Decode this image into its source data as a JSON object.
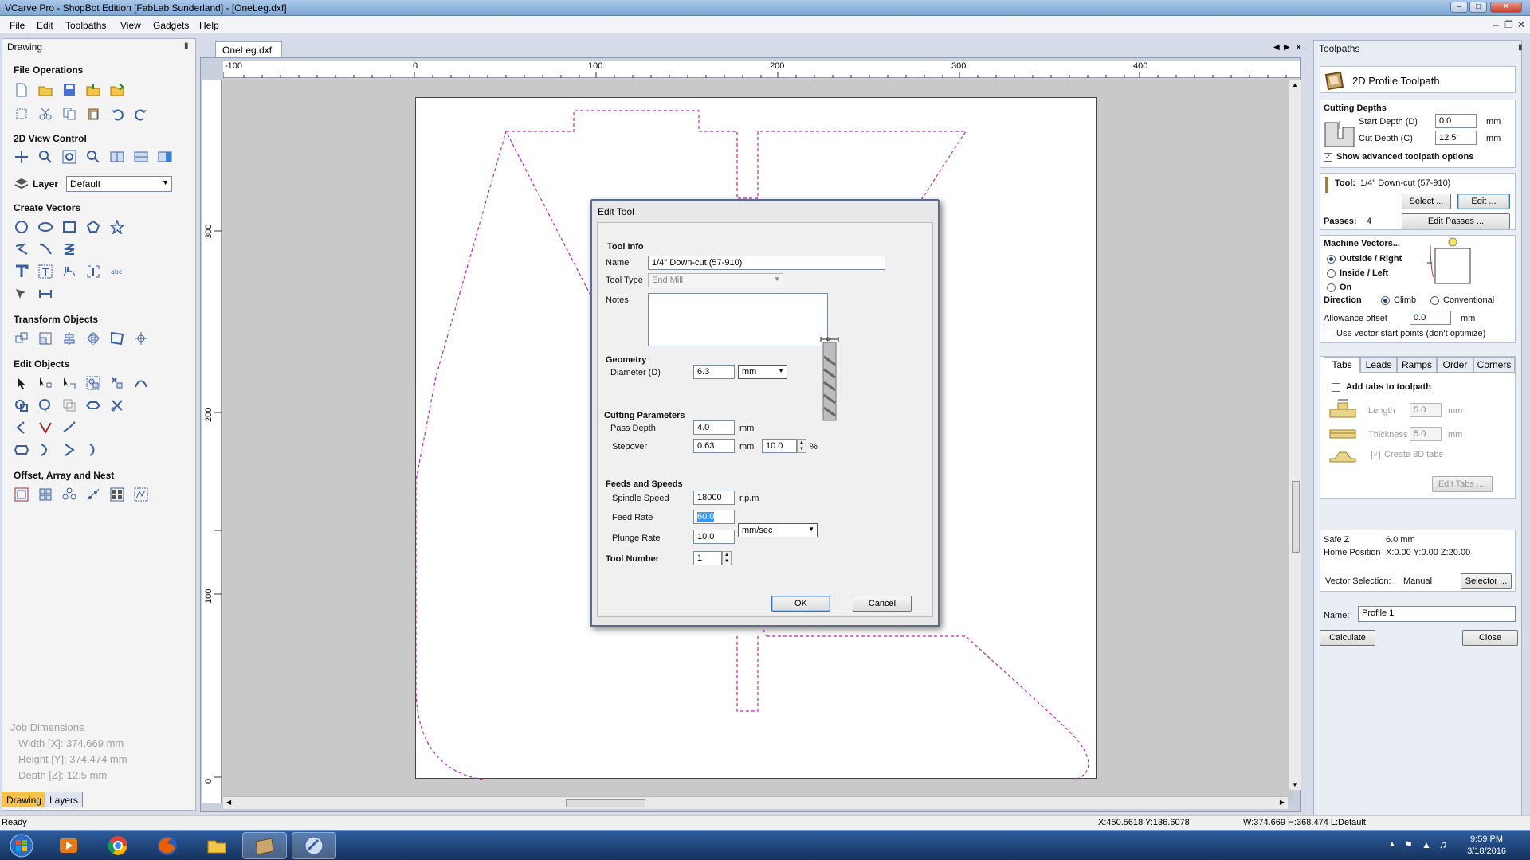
{
  "window": {
    "title": "VCarve Pro - ShopBot Edition [FabLab Sunderland] - [OneLeg.dxf]"
  },
  "menu": [
    "File",
    "Edit",
    "Toolpaths",
    "View",
    "Gadgets",
    "Help"
  ],
  "left_panel": {
    "header": "Drawing",
    "sections": {
      "file_ops": "File Operations",
      "view_ctrl": "2D View Control",
      "layer": "Layer",
      "create_vectors": "Create Vectors",
      "transform": "Transform Objects",
      "edit_objects": "Edit Objects",
      "offset": "Offset, Array and Nest"
    },
    "layer_value": "Default",
    "job_dims": {
      "title": "Job Dimensions",
      "width": "Width  [X]: 374.669 mm",
      "height": "Height [Y]: 374.474 mm",
      "depth": "Depth  [Z]: 12.5 mm"
    },
    "tabs": [
      "Drawing",
      "Layers"
    ]
  },
  "document": {
    "tab": "OneLeg.dxf"
  },
  "ruler": {
    "h_labels": [
      "-100",
      "0",
      "100",
      "200",
      "300",
      "400"
    ],
    "v_labels": [
      "300",
      "200",
      "100",
      "0"
    ]
  },
  "dialog": {
    "title": "Edit Tool",
    "tool_info": "Tool Info",
    "name_label": "Name",
    "name_value": "1/4\" Down-cut (57-910)",
    "type_label": "Tool Type",
    "type_value": "End Mill",
    "notes_label": "Notes",
    "geometry": "Geometry",
    "diameter_label": "Diameter (D)",
    "diameter_value": "6.3",
    "diameter_unit": "mm",
    "cutting": "Cutting Parameters",
    "pass_depth_label": "Pass Depth",
    "pass_depth_value": "4.0",
    "pass_depth_unit": "mm",
    "stepover_label": "Stepover",
    "stepover_value": "0.63",
    "stepover_unit": "mm",
    "stepover_pct": "10.0",
    "pct_sign": "%",
    "feeds": "Feeds and Speeds",
    "spindle_label": "Spindle Speed",
    "spindle_value": "18000",
    "spindle_unit": "r.p.m",
    "feed_label": "Feed Rate",
    "feed_value": "60.0",
    "feed_unit": "mm/sec",
    "plunge_label": "Plunge Rate",
    "plunge_value": "10.0",
    "toolnum_label": "Tool Number",
    "toolnum_value": "1",
    "ok": "OK",
    "cancel": "Cancel"
  },
  "right_panel": {
    "header": "Toolpaths",
    "title": "2D Profile Toolpath",
    "depths": "Cutting Depths",
    "start_label": "Start Depth (D)",
    "start_value": "0.0",
    "cut_label": "Cut Depth (C)",
    "cut_value": "12.5",
    "unit": "mm",
    "adv": "Show advanced toolpath options",
    "tool_label": "Tool:",
    "tool_value": "1/4\"  Down-cut (57-910)",
    "select": "Select ...",
    "edit": "Edit ...",
    "passes_label": "Passes:",
    "passes_value": "4",
    "edit_passes": "Edit Passes ...",
    "machine_vectors": "Machine Vectors...",
    "outside": "Outside / Right",
    "inside": "Inside / Left",
    "on": "On",
    "direction": "Direction",
    "climb": "Climb",
    "conventional": "Conventional",
    "allowance_label": "Allowance offset",
    "allowance_value": "0.0",
    "vector_start": "Use vector start points (don't optimize)",
    "tabs": [
      "Tabs",
      "Leads",
      "Ramps",
      "Order",
      "Corners"
    ],
    "add_tabs": "Add tabs to toolpath",
    "length_label": "Length",
    "length_value": "5.0",
    "thick_label": "Thickness",
    "thick_value": "5.0",
    "create3d": "Create 3D tabs",
    "edit_tabs": "Edit Tabs ....",
    "safe_z_label": "Safe Z",
    "safe_z_value": "6.0 mm",
    "home_label": "Home Position",
    "home_value": "X:0.00 Y:0.00 Z:20.00",
    "vecsel_label": "Vector Selection:",
    "vecsel_value": "Manual",
    "selector": "Selector ...",
    "name_label": "Name:",
    "name_value": "Profile 1",
    "calculate": "Calculate",
    "close": "Close"
  },
  "status": {
    "left": "Ready",
    "coords": "X:450.5618 Y:136.6078",
    "dims": "W:374.669  H:368.474  L:Default"
  },
  "clock": {
    "time": "9:59 PM",
    "date": "3/18/2016"
  }
}
